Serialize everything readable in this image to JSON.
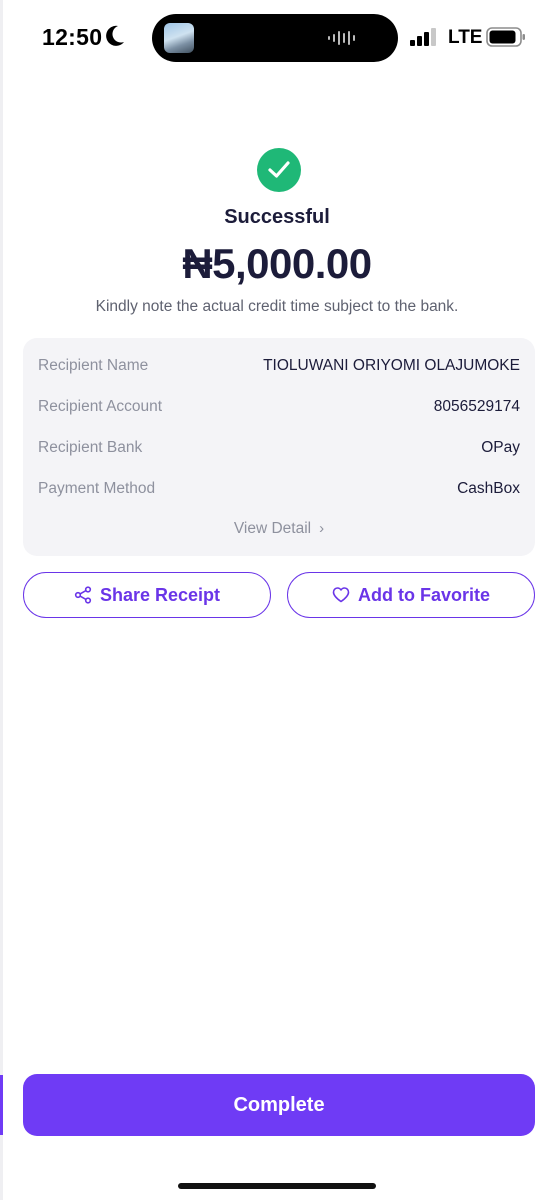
{
  "status_bar": {
    "time": "12:50",
    "network": "LTE"
  },
  "result": {
    "title": "Successful",
    "amount": "₦5,000.00",
    "note": "Kindly note the actual credit time subject to the bank.",
    "status_color": "#1fb877"
  },
  "details": {
    "rows": [
      {
        "label": "Recipient Name",
        "value": "TIOLUWANI ORIYOMI OLAJUMOKE"
      },
      {
        "label": "Recipient Account",
        "value": "8056529174"
      },
      {
        "label": "Recipient Bank",
        "value": "OPay"
      },
      {
        "label": "Payment Method",
        "value": "CashBox"
      }
    ],
    "view_detail_label": "View Detail"
  },
  "actions": {
    "share_label": "Share Receipt",
    "favorite_label": "Add to Favorite",
    "complete_label": "Complete"
  },
  "colors": {
    "accent": "#6f3bf5",
    "text": "#1c1c3a",
    "card": "#f4f4f7"
  },
  "icons": [
    "moon-icon",
    "cellular-signal-icon",
    "battery-icon",
    "checkmark-icon",
    "share-icon",
    "heart-icon",
    "chevron-right-icon"
  ]
}
